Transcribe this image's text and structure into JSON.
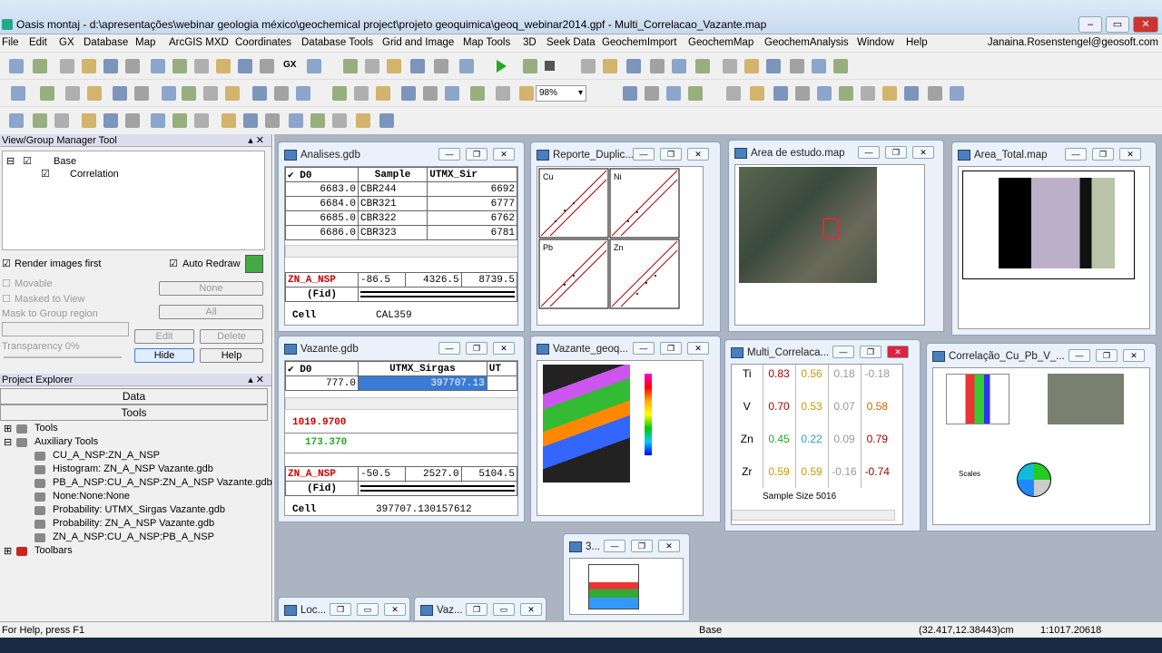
{
  "titlebar": {
    "title": "Oasis montaj - d:\\apresentações\\webinar geologia méxico\\geochemical project\\projeto geoquimica\\geoq_webinar2014.gpf - Multi_Correlacao_Vazante.map"
  },
  "menu": [
    "File",
    "Edit",
    "GX",
    "Database",
    "Map",
    "ArcGIS MXD",
    "Coordinates",
    "Database Tools",
    "Grid and Image",
    "Map Tools",
    "3D",
    "Seek Data",
    "GeochemImport",
    "GeochemMap",
    "GeochemAnalysis",
    "Window",
    "Help"
  ],
  "user_email": "Janaina.Rosenstengel@geosoft.com",
  "toolbar": {
    "gx_label": "GX",
    "zoom_value": "98%"
  },
  "view_group_manager": {
    "title": "View/Group Manager Tool",
    "tree": [
      "Base",
      "Correlation"
    ],
    "render_images_first": "Render images first",
    "auto_redraw": "Auto Redraw",
    "movable": "Movable",
    "masked_to_view": "Masked to View",
    "mask_to_group_region": "Mask to Group region",
    "none_btn": "None",
    "all_btn": "All",
    "transparency": "Transparency 0%",
    "edit": "Edit",
    "delete": "Delete",
    "hide": "Hide",
    "help": "Help"
  },
  "project_explorer": {
    "title": "Project Explorer",
    "tab_data": "Data",
    "tab_tools": "Tools",
    "items": [
      "Tools",
      "Auxiliary Tools",
      "CU_A_NSP:ZN_A_NSP",
      "Histogram: ZN_A_NSP Vazante.gdb",
      "PB_A_NSP:CU_A_NSP:ZN_A_NSP Vazante.gdb",
      "None:None:None",
      "Probability: UTMX_Sirgas Vazante.gdb",
      "Probability: ZN_A_NSP Vazante.gdb",
      "ZN_A_NSP:CU_A_NSP:PB_A_NSP",
      "Toolbars"
    ]
  },
  "windows": {
    "analises": {
      "title": "Analises.gdb",
      "headers": [
        "D0",
        "Sample",
        "UTMX_Sir"
      ],
      "rows": [
        [
          "6683.0",
          "CBR244",
          "6692"
        ],
        [
          "6684.0",
          "CBR321",
          "6777"
        ],
        [
          "6685.0",
          "CBR322",
          "6762"
        ],
        [
          "6686.0",
          "CBR323",
          "6781"
        ]
      ],
      "stat_label": "ZN_A_NSP",
      "stat_vals": [
        "-86.5",
        "4326.5",
        "8739.5"
      ],
      "fid": "(Fid)",
      "cell_label": "Cell",
      "cell_val": "CAL359"
    },
    "reporte": {
      "title": "Reporte_Duplic...",
      "labels": [
        "Cu",
        "Ni",
        "Pb",
        "Zn"
      ]
    },
    "area_estudo": {
      "title": "Area de estudo.map"
    },
    "area_total": {
      "title": "Area_Total.map"
    },
    "vazante_gdb": {
      "title": "Vazante.gdb",
      "h_d0": "D0",
      "h_utmx": "UTMX_Sirgas",
      "h_ut": "UT",
      "d0_val": "777.0",
      "utmx_val": "397707.13",
      "prof1_val": "1019.9700",
      "prof2_val": "173.370",
      "stat_label": "ZN_A_NSP",
      "stat_vals": [
        "-50.5",
        "2527.0",
        "5104.5"
      ],
      "fid": "(Fid)",
      "cell_label": "Cell",
      "cell_val": "397707.130157612"
    },
    "vazante_geo": {
      "title": "Vazante_geoq..."
    },
    "multi": {
      "title": "Multi_Correlaca...",
      "rows": [
        {
          "label": "Ti",
          "vals": [
            "0.83",
            "0.56",
            "0.18",
            "-0.18"
          ]
        },
        {
          "label": "V",
          "vals": [
            "0.70",
            "0.53",
            "0.07",
            "0.58"
          ]
        },
        {
          "label": "Zn",
          "vals": [
            "0.45",
            "0.22",
            "0.09",
            "0.79"
          ]
        },
        {
          "label": "Zr",
          "vals": [
            "0.59",
            "0.59",
            "-0.16",
            "-0.74"
          ]
        }
      ],
      "sample_size": "Sample Size  5016"
    },
    "correlacao": {
      "title": "Correlação_Cu_Pb_V_...",
      "scales": "Scales"
    },
    "three_d": {
      "title": "3..."
    },
    "loc": {
      "title": "Loc..."
    },
    "vaz2": {
      "title": "Vaz..."
    }
  },
  "status": {
    "help": "For Help, press F1",
    "view": "Base",
    "coords": "(32.417,12.38443)cm",
    "scale": "1:1017.20618"
  }
}
